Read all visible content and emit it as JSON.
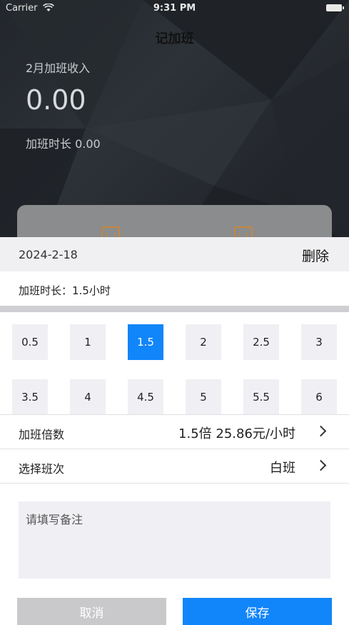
{
  "status_bar": {
    "carrier": "Carrier",
    "time": "9:31 PM"
  },
  "header": {
    "title": "记加班",
    "income_label": "2月加班收入",
    "income_value": "0.00",
    "duration_summary": "加班时长 0.00"
  },
  "sheet": {
    "date": "2024-2-18",
    "delete_label": "删除",
    "duration_text": "加班时长：1.5小时",
    "hours": [
      "0.5",
      "1",
      "1.5",
      "2",
      "2.5",
      "3",
      "3.5",
      "4",
      "4.5",
      "5",
      "5.5",
      "6"
    ],
    "selected_hour": "1.5",
    "multiplier_label": "加班倍数",
    "multiplier_value": "1.5倍 25.86元/小时",
    "shift_label": "选择班次",
    "shift_value": "白班",
    "remark_placeholder": "请填写备注",
    "cancel_label": "取消",
    "save_label": "保存"
  },
  "colors": {
    "accent": "#1185fa",
    "calendar_icon": "#c6873a"
  }
}
